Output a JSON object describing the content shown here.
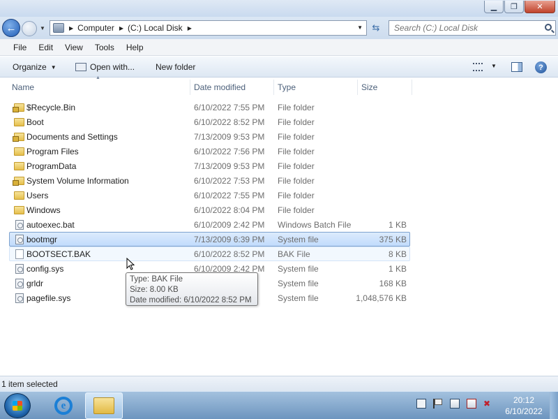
{
  "window": {
    "buttons": {
      "minimize": "▁",
      "maximize": "❐",
      "close": "✕"
    }
  },
  "address": {
    "crumbs": [
      "Computer",
      "(C:) Local Disk"
    ],
    "search_placeholder": "Search (C:) Local Disk"
  },
  "menu": {
    "items": [
      "File",
      "Edit",
      "View",
      "Tools",
      "Help"
    ]
  },
  "toolbar": {
    "organize": "Organize",
    "open_with": "Open with...",
    "new_folder": "New folder"
  },
  "columns": {
    "name": "Name",
    "date": "Date modified",
    "type": "Type",
    "size": "Size"
  },
  "files": [
    {
      "name": "$Recycle.Bin",
      "date": "6/10/2022 7:55 PM",
      "type": "File folder",
      "size": "",
      "icon": "locked-folder-icon"
    },
    {
      "name": "Boot",
      "date": "6/10/2022 8:52 PM",
      "type": "File folder",
      "size": "",
      "icon": "folder-icon"
    },
    {
      "name": "Documents and Settings",
      "date": "7/13/2009 9:53 PM",
      "type": "File folder",
      "size": "",
      "icon": "locked-folder-icon"
    },
    {
      "name": "Program Files",
      "date": "6/10/2022 7:56 PM",
      "type": "File folder",
      "size": "",
      "icon": "folder-icon"
    },
    {
      "name": "ProgramData",
      "date": "7/13/2009 9:53 PM",
      "type": "File folder",
      "size": "",
      "icon": "folder-icon"
    },
    {
      "name": "System Volume Information",
      "date": "6/10/2022 7:53 PM",
      "type": "File folder",
      "size": "",
      "icon": "locked-folder-icon"
    },
    {
      "name": "Users",
      "date": "6/10/2022 7:55 PM",
      "type": "File folder",
      "size": "",
      "icon": "folder-icon"
    },
    {
      "name": "Windows",
      "date": "6/10/2022 8:04 PM",
      "type": "File folder",
      "size": "",
      "icon": "folder-icon"
    },
    {
      "name": "autoexec.bat",
      "date": "6/10/2009 2:42 PM",
      "type": "Windows Batch File",
      "size": "1 KB",
      "icon": "batch-file-icon"
    },
    {
      "name": "bootmgr",
      "date": "7/13/2009 6:39 PM",
      "type": "System file",
      "size": "375 KB",
      "icon": "system-file-icon"
    },
    {
      "name": "BOOTSECT.BAK",
      "date": "6/10/2022 8:52 PM",
      "type": "BAK File",
      "size": "8 KB",
      "icon": "file-icon"
    },
    {
      "name": "config.sys",
      "date": "6/10/2009 2:42 PM",
      "type": "System file",
      "size": "1 KB",
      "icon": "system-file-icon"
    },
    {
      "name": "grldr",
      "date": "",
      "type": "System file",
      "size": "168 KB",
      "icon": "system-file-icon"
    },
    {
      "name": "pagefile.sys",
      "date": "M",
      "type": "System file",
      "size": "1,048,576 KB",
      "icon": "system-file-icon"
    }
  ],
  "selected_index": 9,
  "hover_index": 10,
  "tooltip": {
    "type": "Type: BAK File",
    "size": "Size: 8.00 KB",
    "date": "Date modified: 6/10/2022 8:52 PM"
  },
  "status": {
    "text": "1 item selected"
  },
  "taskbar": {
    "time": "20:12",
    "date": "6/10/2022"
  },
  "colors": {
    "selection": "#c1dbfc",
    "selection_border": "#7da2ce",
    "folder": "#e5bf4c"
  }
}
